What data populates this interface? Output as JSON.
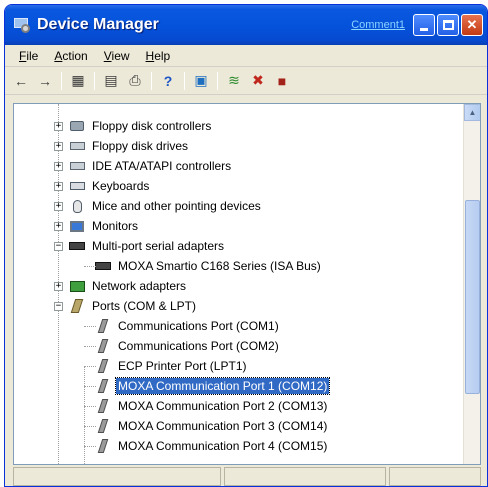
{
  "window": {
    "title": "Device Manager",
    "comment_link": "Comment1"
  },
  "menu": [
    "File",
    "Action",
    "View",
    "Help"
  ],
  "menu_underline": [
    "F",
    "A",
    "V",
    "H"
  ],
  "toolbar_icons": [
    "back-arrow-icon",
    "forward-arrow-icon",
    "show-hide-tree-icon",
    "properties-icon",
    "print-icon",
    "help-icon",
    "scan-hardware-icon",
    "update-driver-icon",
    "disable-device-icon",
    "uninstall-device-icon"
  ],
  "tree": [
    {
      "label": "Floppy disk controllers",
      "icon": "floppy-controller-icon",
      "expander": "+",
      "level": 1
    },
    {
      "label": "Floppy disk drives",
      "icon": "floppy-drive-icon",
      "expander": "+",
      "level": 1
    },
    {
      "label": "IDE ATA/ATAPI controllers",
      "icon": "ide-controller-icon",
      "expander": "+",
      "level": 1
    },
    {
      "label": "Keyboards",
      "icon": "keyboard-icon",
      "expander": "+",
      "level": 1
    },
    {
      "label": "Mice and other pointing devices",
      "icon": "mouse-icon",
      "expander": "+",
      "level": 1
    },
    {
      "label": "Monitors",
      "icon": "monitor-icon",
      "expander": "+",
      "level": 1
    },
    {
      "label": "Multi-port serial adapters",
      "icon": "serial-adapter-icon",
      "expander": "−",
      "level": 1
    },
    {
      "label": "MOXA Smartio C168 Series (ISA Bus)",
      "icon": "serial-adapter-icon",
      "expander": "",
      "level": 2
    },
    {
      "label": "Network adapters",
      "icon": "network-adapter-icon",
      "expander": "+",
      "level": 1
    },
    {
      "label": "Ports (COM & LPT)",
      "icon": "ports-icon",
      "expander": "−",
      "level": 1
    },
    {
      "label": "Communications Port (COM1)",
      "icon": "port-icon",
      "expander": "",
      "level": 2
    },
    {
      "label": "Communications Port (COM2)",
      "icon": "port-icon",
      "expander": "",
      "level": 2
    },
    {
      "label": "ECP Printer Port (LPT1)",
      "icon": "port-icon",
      "expander": "",
      "level": 2
    },
    {
      "label": "MOXA Communication Port 1 (COM12)",
      "icon": "port-icon",
      "expander": "",
      "level": 2,
      "selected": true
    },
    {
      "label": "MOXA Communication Port 2 (COM13)",
      "icon": "port-icon",
      "expander": "",
      "level": 2
    },
    {
      "label": "MOXA Communication Port 3 (COM14)",
      "icon": "port-icon",
      "expander": "",
      "level": 2
    },
    {
      "label": "MOXA Communication Port 4 (COM15)",
      "icon": "port-icon",
      "expander": "",
      "level": 2
    }
  ],
  "colors": {
    "titlebar": "#0553db",
    "selection": "#316ac5",
    "chrome": "#ece9d8"
  }
}
